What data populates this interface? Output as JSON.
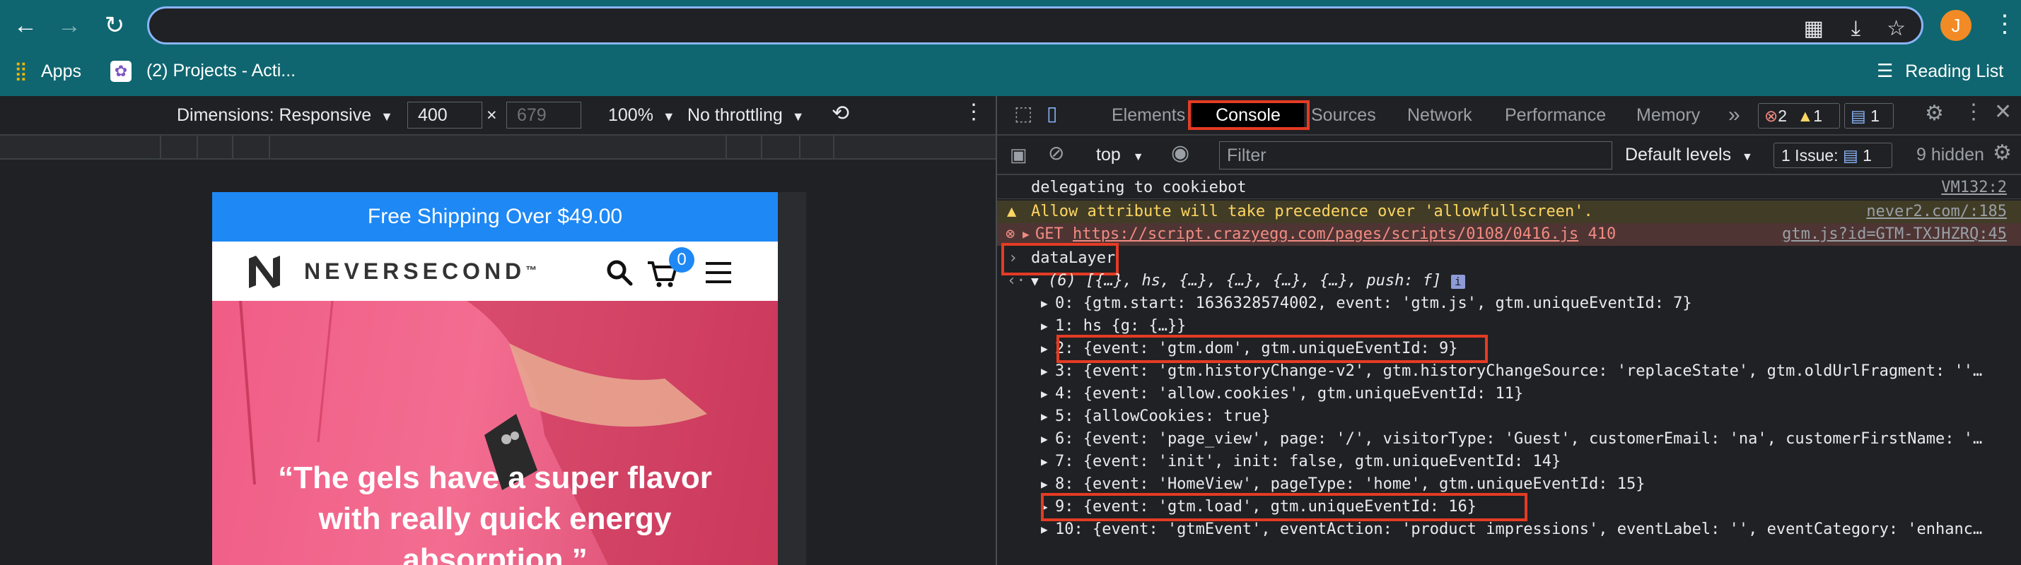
{
  "browser": {
    "address_value": "",
    "avatar_letter": "J",
    "bookmarks": [
      {
        "label": "Apps"
      },
      {
        "label": "(2) Projects - Acti..."
      }
    ],
    "reading_list": "Reading List"
  },
  "device_toolbar": {
    "dimensions": "Dimensions: Responsive",
    "width": "400",
    "height_placeholder": "679",
    "times": "×",
    "zoom": "100%",
    "throttling": "No throttling"
  },
  "site": {
    "shipping_banner": "Free Shipping Over $49.00",
    "logo_text": "NEVERSECOND",
    "logo_tm": "™",
    "cart_count": "0",
    "hero_quote_line1": "“The gels have a super flavor",
    "hero_quote_line2": "with really quick energy",
    "hero_quote_line3": "absorption.”"
  },
  "devtools": {
    "tabs": [
      "Elements",
      "Console",
      "Sources",
      "Network",
      "Performance",
      "Memory"
    ],
    "more": "»",
    "errors": "2",
    "warnings": "1",
    "messages": "1",
    "context": "top",
    "filter_placeholder": "Filter",
    "levels": "Default levels",
    "issues_label": "1 Issue:",
    "issues_count": "1",
    "hidden": "9 hidden",
    "console": {
      "line1_text": "delegating to cookiebot",
      "line1_src": "VM132:2",
      "warn_text": "Allow attribute will take precedence over 'allowfullscreen'.",
      "warn_src": "never2.com/:185",
      "err_method": "GET",
      "err_url": "https://script.crazyegg.com/pages/scripts/0108/0416.js",
      "err_code": "410",
      "err_src": "gtm.js?id=GTM-TXJHZRQ:45",
      "input": "dataLayer",
      "result_head": "(6) [{…}, hs, {…}, {…}, {…}, {…}, push: f]",
      "items": [
        "0: {gtm.start: 1636328574002, event: 'gtm.js', gtm.uniqueEventId: 7}",
        "1: hs {g: {…}}",
        "2: {event: 'gtm.dom', gtm.uniqueEventId: 9}",
        "3: {event: 'gtm.historyChange-v2', gtm.historyChangeSource: 'replaceState', gtm.oldUrlFragment: ''…",
        "4: {event: 'allow.cookies', gtm.uniqueEventId: 11}",
        "5: {allowCookies: true}",
        "6: {event: 'page_view', page: '/', visitorType: 'Guest', customerEmail: 'na', customerFirstName: '…",
        "7: {event: 'init', init: false, gtm.uniqueEventId: 14}",
        "8: {event: 'HomeView', pageType: 'home', gtm.uniqueEventId: 15}",
        "9: {event: 'gtm.load', gtm.uniqueEventId: 16}",
        "10: {event: 'gtmEvent', eventAction: 'product impressions', eventLabel: '', eventCategory: 'enhanc…"
      ]
    }
  },
  "colors": {
    "chrome": "#0f6670",
    "accent": "#e53b24",
    "shipping": "#1e88f5"
  }
}
